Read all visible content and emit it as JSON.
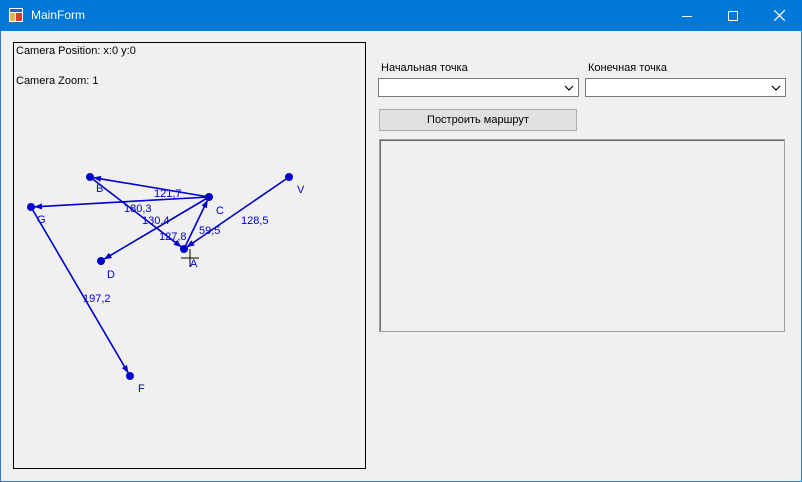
{
  "window": {
    "title": "MainForm"
  },
  "canvas": {
    "camera_position": "Camera Position: x:0 y:0",
    "camera_zoom": "Camera Zoom: 1"
  },
  "graph": {
    "nodes": [
      {
        "id": "A",
        "label": "A"
      },
      {
        "id": "B",
        "label": "B"
      },
      {
        "id": "C",
        "label": "C"
      },
      {
        "id": "D",
        "label": "D"
      },
      {
        "id": "F",
        "label": "F"
      },
      {
        "id": "G",
        "label": "G"
      },
      {
        "id": "V",
        "label": "V"
      }
    ],
    "edges": [
      {
        "from": "V",
        "to": "A",
        "weight": "128,5"
      },
      {
        "from": "C",
        "to": "B",
        "weight": "121,7"
      },
      {
        "from": "C",
        "to": "G",
        "weight": "180,3"
      },
      {
        "from": "C",
        "to": "D",
        "weight": "130,4"
      },
      {
        "from": "B",
        "to": "A",
        "weight": "127,8"
      },
      {
        "from": "A",
        "to": "C",
        "weight": "59,5"
      },
      {
        "from": "G",
        "to": "F",
        "weight": "197,2"
      }
    ],
    "color": "#0000cc"
  },
  "controls": {
    "start_label": "Начальная точка",
    "end_label": "Конечная точка",
    "start_value": "",
    "end_value": "",
    "build_button": "Построить маршрут",
    "result_text": ""
  }
}
